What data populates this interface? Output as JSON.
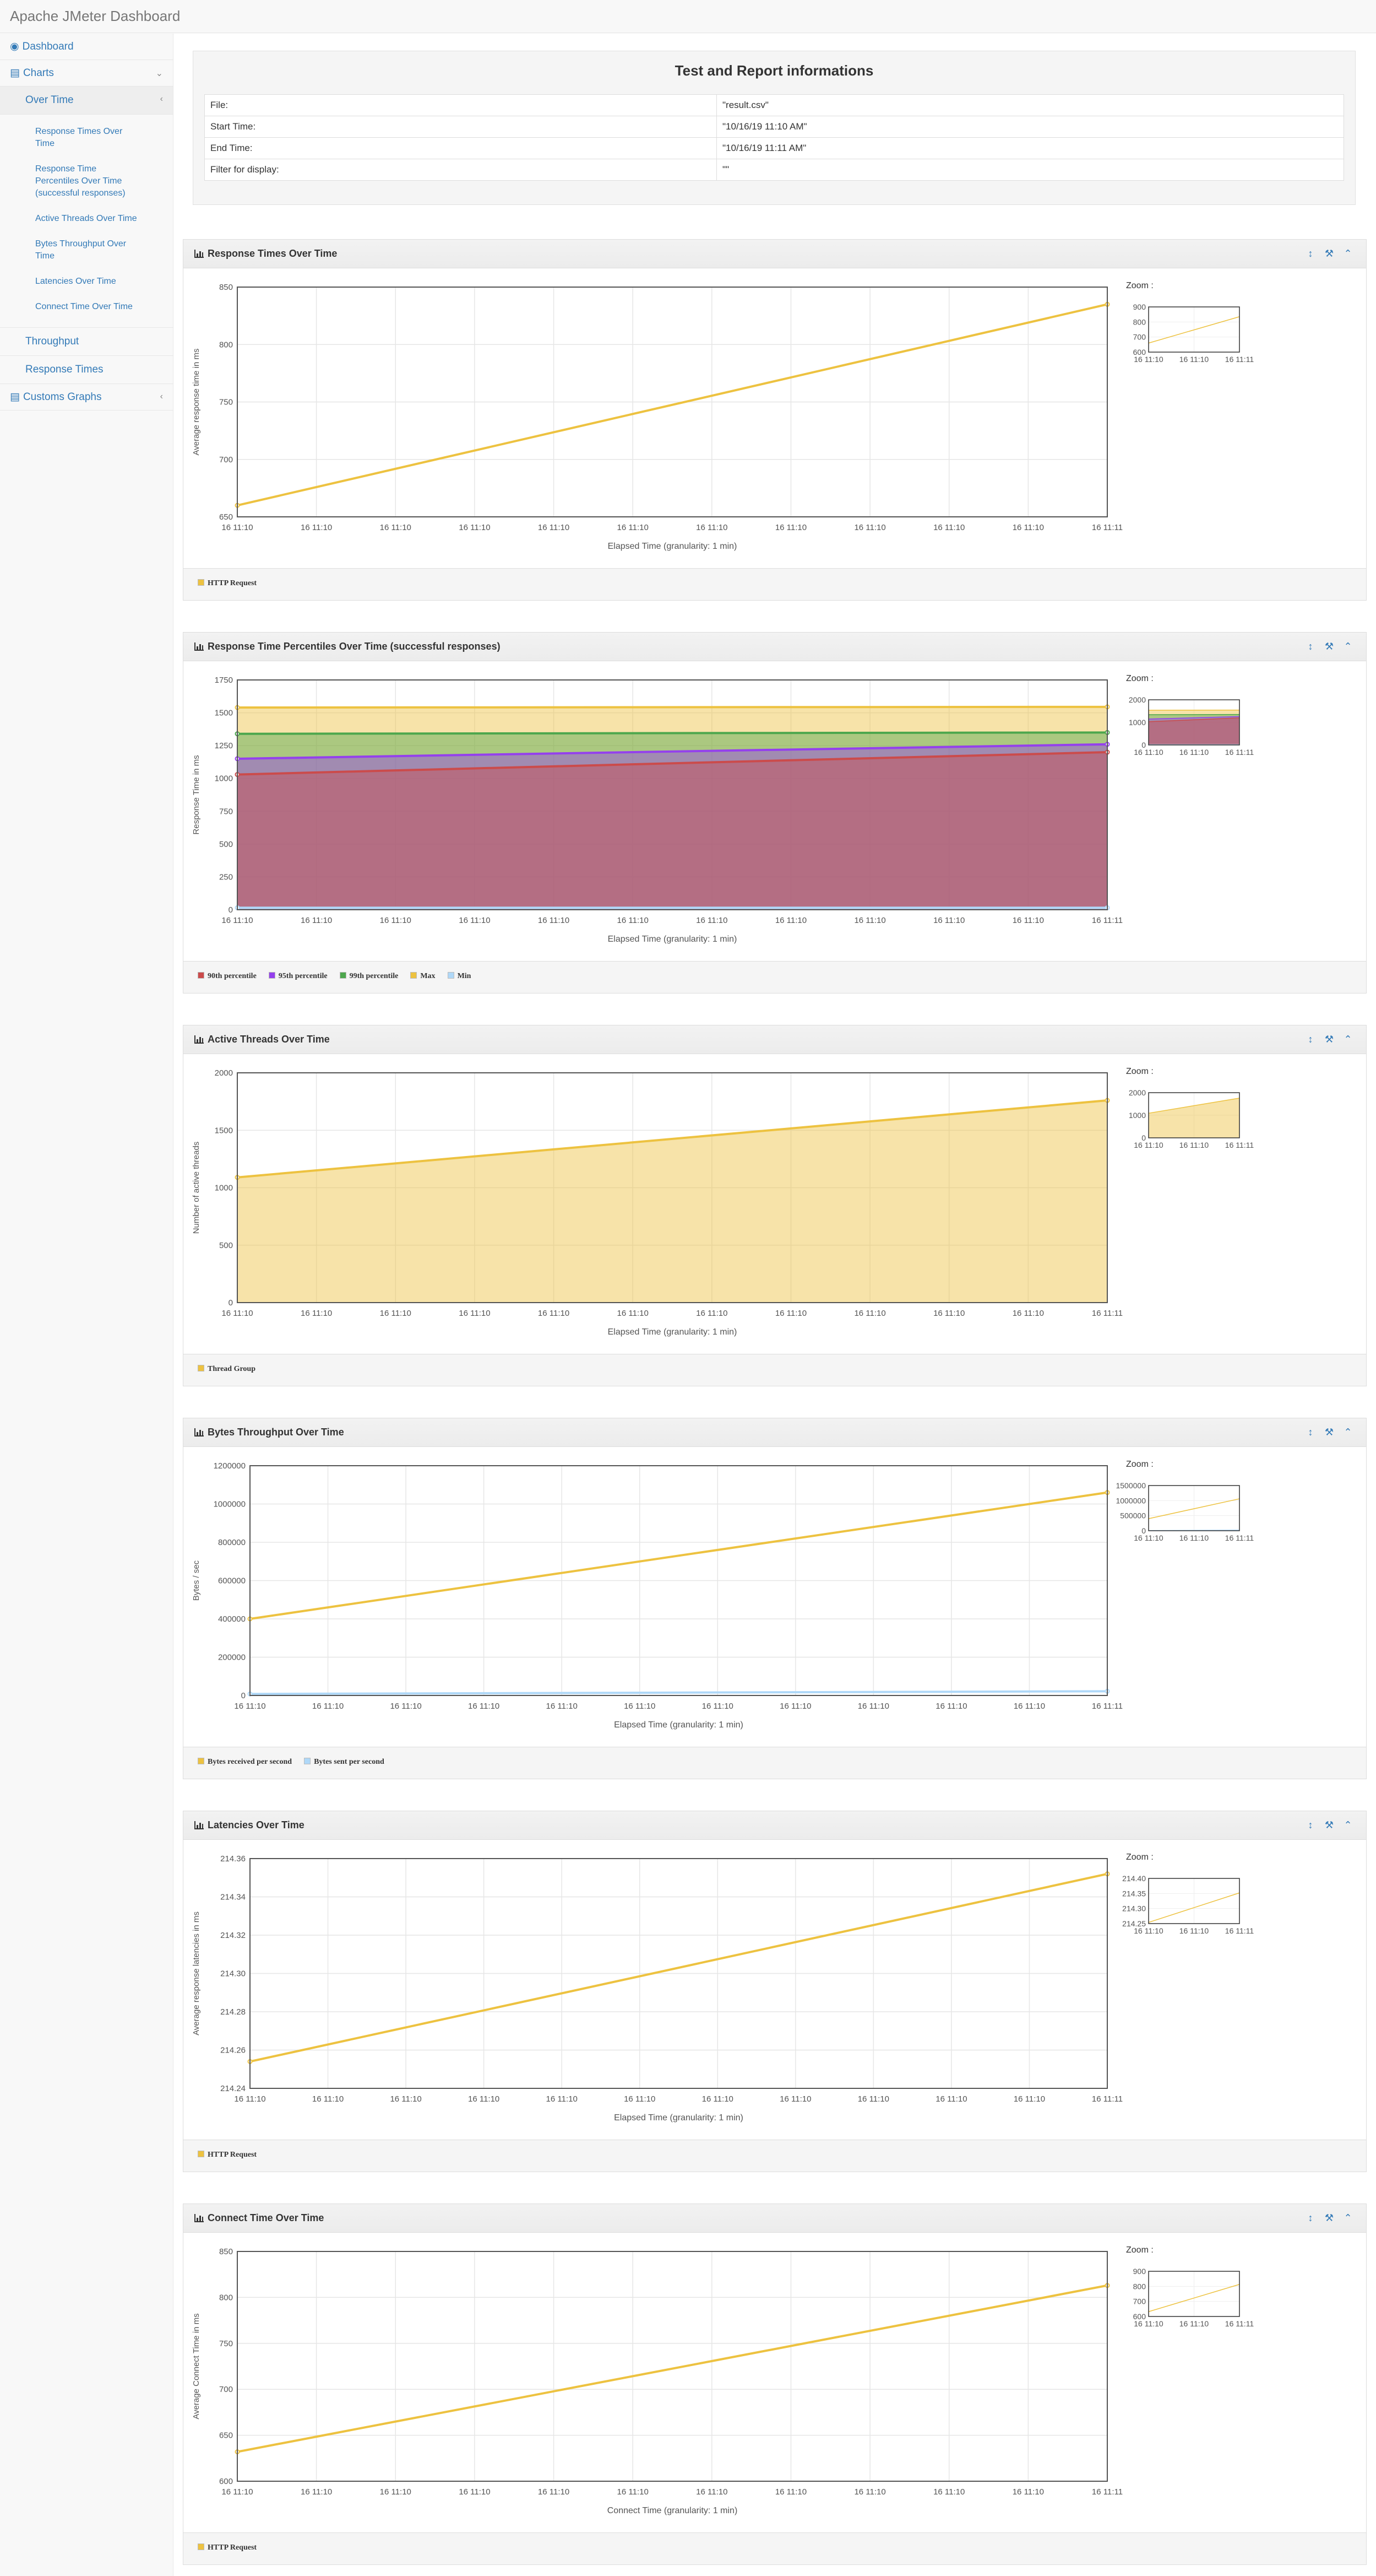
{
  "app": {
    "title": "Apache JMeter Dashboard"
  },
  "sidebar": {
    "dashboard": "Dashboard",
    "charts": "Charts",
    "over_time": "Over Time",
    "over_time_items": [
      "Response Times Over Time",
      "Response Time Percentiles Over Time (successful responses)",
      "Active Threads Over Time",
      "Bytes Throughput Over Time",
      "Latencies Over Time",
      "Connect Time Over Time"
    ],
    "throughput": "Throughput",
    "response_times": "Response Times",
    "custom_graphs": "Customs Graphs"
  },
  "info": {
    "title": "Test and Report informations",
    "rows": [
      {
        "label": "File:",
        "value": "\"result.csv\""
      },
      {
        "label": "Start Time:",
        "value": "\"10/16/19 11:10 AM\""
      },
      {
        "label": "End Time:",
        "value": "\"10/16/19 11:11 AM\""
      },
      {
        "label": "Filter for display:",
        "value": "\"\""
      }
    ]
  },
  "zoom_label": "Zoom :",
  "colors": {
    "yellow": "#edc240",
    "yellow_fill": "#f7e1a6",
    "red": "#cb4b4b",
    "purple": "#9440ed",
    "green": "#4da74d",
    "blue": "#afd8f8"
  },
  "chart_data": [
    {
      "type": "line",
      "title": "Response Times Over Time",
      "xlabel": "Elapsed Time (granularity: 1 min)",
      "ylabel": "Average response time in ms",
      "x_ticks": [
        "16 11:10",
        "16 11:10",
        "16 11:10",
        "16 11:10",
        "16 11:10",
        "16 11:10",
        "16 11:10",
        "16 11:10",
        "16 11:10",
        "16 11:10",
        "16 11:10",
        "16 11:11"
      ],
      "y_ticks": [
        "650",
        "700",
        "750",
        "800",
        "850"
      ],
      "ylim": [
        650,
        850
      ],
      "series": [
        {
          "name": "HTTP Request",
          "color": "#edc240",
          "values": [
            660,
            835
          ]
        }
      ],
      "zoom": {
        "y_ticks": [
          "600",
          "700",
          "800",
          "900"
        ],
        "ylim": [
          600,
          900
        ],
        "x_ticks": [
          "16 11:10",
          "16 11:10",
          "16 11:11"
        ]
      }
    },
    {
      "type": "area",
      "title": "Response Time Percentiles Over Time (successful responses)",
      "xlabel": "Elapsed Time (granularity: 1 min)",
      "ylabel": "Response Time in ms",
      "x_ticks": [
        "16 11:10",
        "16 11:10",
        "16 11:10",
        "16 11:10",
        "16 11:10",
        "16 11:10",
        "16 11:10",
        "16 11:10",
        "16 11:10",
        "16 11:10",
        "16 11:10",
        "16 11:11"
      ],
      "y_ticks": [
        "0",
        "250",
        "500",
        "750",
        "1000",
        "1250",
        "1500",
        "1750"
      ],
      "ylim": [
        0,
        1750
      ],
      "series": [
        {
          "name": "90th percentile",
          "color": "#cb4b4b",
          "values": [
            1030,
            1200
          ]
        },
        {
          "name": "95th percentile",
          "color": "#9440ed",
          "values": [
            1150,
            1260
          ]
        },
        {
          "name": "99th percentile",
          "color": "#4da74d",
          "values": [
            1340,
            1350
          ]
        },
        {
          "name": "Max",
          "color": "#edc240",
          "values": [
            1540,
            1545
          ]
        },
        {
          "name": "Min",
          "color": "#afd8f8",
          "values": [
            15,
            15
          ]
        }
      ],
      "zoom": {
        "y_ticks": [
          "0",
          "1000",
          "2000"
        ],
        "ylim": [
          0,
          2000
        ],
        "x_ticks": [
          "16 11:10",
          "16 11:10",
          "16 11:11"
        ]
      }
    },
    {
      "type": "area",
      "title": "Active Threads Over Time",
      "xlabel": "Elapsed Time (granularity: 1 min)",
      "ylabel": "Number of active threads",
      "x_ticks": [
        "16 11:10",
        "16 11:10",
        "16 11:10",
        "16 11:10",
        "16 11:10",
        "16 11:10",
        "16 11:10",
        "16 11:10",
        "16 11:10",
        "16 11:10",
        "16 11:10",
        "16 11:11"
      ],
      "y_ticks": [
        "0",
        "500",
        "1000",
        "1500",
        "2000"
      ],
      "ylim": [
        0,
        2000
      ],
      "series": [
        {
          "name": "Thread Group",
          "color": "#edc240",
          "values": [
            1090,
            1760
          ]
        }
      ],
      "zoom": {
        "y_ticks": [
          "0",
          "1000",
          "2000"
        ],
        "ylim": [
          0,
          2000
        ],
        "x_ticks": [
          "16 11:10",
          "16 11:10",
          "16 11:11"
        ]
      }
    },
    {
      "type": "line",
      "title": "Bytes Throughput Over Time",
      "xlabel": "Elapsed Time (granularity: 1 min)",
      "ylabel": "Bytes / sec",
      "x_ticks": [
        "16 11:10",
        "16 11:10",
        "16 11:10",
        "16 11:10",
        "16 11:10",
        "16 11:10",
        "16 11:10",
        "16 11:10",
        "16 11:10",
        "16 11:10",
        "16 11:10",
        "16 11:11"
      ],
      "y_ticks": [
        "0",
        "200000",
        "400000",
        "600000",
        "800000",
        "1000000",
        "1200000"
      ],
      "ylim": [
        0,
        1200000
      ],
      "series": [
        {
          "name": "Bytes received per second",
          "color": "#edc240",
          "values": [
            400000,
            1060000
          ]
        },
        {
          "name": "Bytes sent per second",
          "color": "#afd8f8",
          "values": [
            8000,
            22000
          ]
        }
      ],
      "zoom": {
        "y_ticks": [
          "0",
          "500000",
          "1000000",
          "1500000"
        ],
        "ylim": [
          0,
          1500000
        ],
        "x_ticks": [
          "16 11:10",
          "16 11:10",
          "16 11:11"
        ]
      }
    },
    {
      "type": "line",
      "title": "Latencies Over Time",
      "xlabel": "Elapsed Time (granularity: 1 min)",
      "ylabel": "Average response latencies in ms",
      "x_ticks": [
        "16 11:10",
        "16 11:10",
        "16 11:10",
        "16 11:10",
        "16 11:10",
        "16 11:10",
        "16 11:10",
        "16 11:10",
        "16 11:10",
        "16 11:10",
        "16 11:10",
        "16 11:11"
      ],
      "y_ticks": [
        "214.24",
        "214.26",
        "214.28",
        "214.30",
        "214.32",
        "214.34",
        "214.36"
      ],
      "ylim": [
        214.24,
        214.36
      ],
      "series": [
        {
          "name": "HTTP Request",
          "color": "#edc240",
          "values": [
            214.254,
            214.352
          ]
        }
      ],
      "zoom": {
        "y_ticks": [
          "214.25",
          "214.30",
          "214.35",
          "214.40"
        ],
        "ylim": [
          214.25,
          214.4
        ],
        "x_ticks": [
          "16 11:10",
          "16 11:10",
          "16 11:11"
        ]
      }
    },
    {
      "type": "line",
      "title": "Connect Time Over Time",
      "xlabel": "Connect Time (granularity: 1 min)",
      "ylabel": "Average Connect Time in ms",
      "x_ticks": [
        "16 11:10",
        "16 11:10",
        "16 11:10",
        "16 11:10",
        "16 11:10",
        "16 11:10",
        "16 11:10",
        "16 11:10",
        "16 11:10",
        "16 11:10",
        "16 11:10",
        "16 11:11"
      ],
      "y_ticks": [
        "600",
        "650",
        "700",
        "750",
        "800",
        "850"
      ],
      "ylim": [
        600,
        850
      ],
      "series": [
        {
          "name": "HTTP Request",
          "color": "#edc240",
          "values": [
            632,
            813
          ]
        }
      ],
      "zoom": {
        "y_ticks": [
          "600",
          "700",
          "800",
          "900"
        ],
        "ylim": [
          600,
          900
        ],
        "x_ticks": [
          "16 11:10",
          "16 11:10",
          "16 11:11"
        ]
      }
    }
  ]
}
